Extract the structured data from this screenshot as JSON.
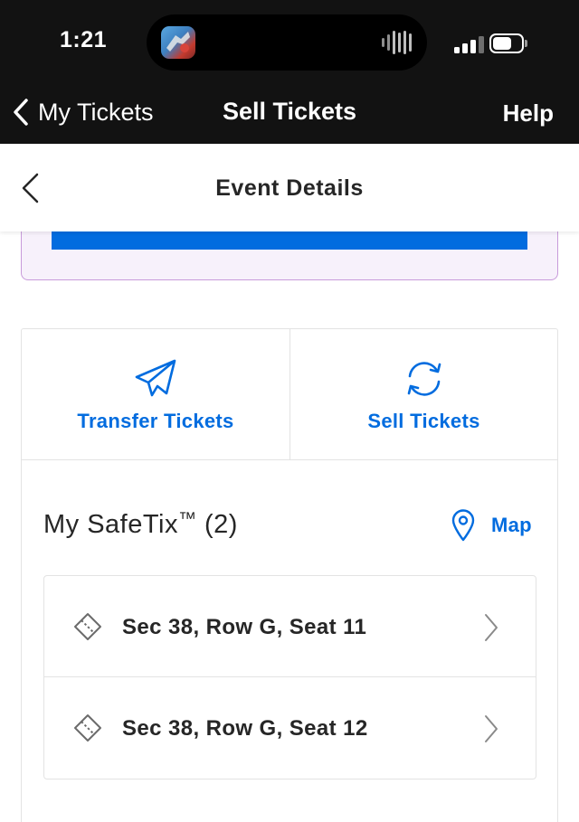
{
  "status_bar": {
    "time": "1:21",
    "signal_colors": [
      "#ffffff",
      "#ffffff",
      "#ffffff",
      "#6e6e6e"
    ]
  },
  "nav": {
    "back_label": "My Tickets",
    "title": "Sell Tickets",
    "help_label": "Help"
  },
  "event_header": {
    "title": "Event Details"
  },
  "actions": {
    "transfer_label": "Transfer Tickets",
    "transfer_icon": "paper-plane-icon",
    "sell_label": "Sell Tickets",
    "sell_icon": "refresh-icon"
  },
  "safetix": {
    "title": "My SafeTix",
    "trademark": "™",
    "count": "(2)",
    "map_label": "Map",
    "map_icon": "map-pin-icon",
    "seats": [
      {
        "label": "Sec 38, Row G, Seat 11"
      },
      {
        "label": "Sec 38, Row G, Seat 12"
      }
    ]
  },
  "colors": {
    "accent": "#026cdf",
    "nav_bg": "#121212",
    "promo_border": "#c89bdb",
    "promo_bg": "#f7f1fb"
  }
}
